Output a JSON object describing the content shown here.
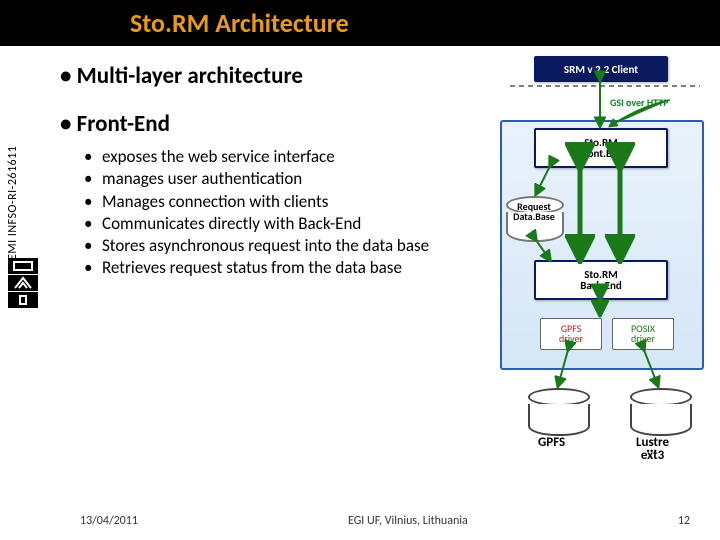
{
  "title": "Sto.RM Architecture",
  "side_id": "EMI INFSO-RI-261611",
  "bullets": {
    "b1": "Multi-layer architecture",
    "b2": "Front-End",
    "sub": [
      "exposes the web service interface",
      "manages user authentication",
      "Manages connection with clients",
      "Communicates directly with Back-End",
      "Stores asynchronous request into the data base",
      "Retrieves request status from the data base"
    ]
  },
  "diagram": {
    "client": "SRM v 2.2 Client",
    "gsi": "GSI over HTTP",
    "frontend_l1": "Sto.RM",
    "frontend_l2": "Front.End",
    "db_l1": "Request",
    "db_l2": "Data.Base",
    "backend_l1": "Sto.RM",
    "backend_l2": "Back.End",
    "gpfs_l1": "GPFS",
    "gpfs_l2": "driver",
    "posix_l1": "POSIX",
    "posix_l2": "driver",
    "fs1": "GPFS",
    "fs2_l1": "Lustre",
    "fs2_l2": "ext3",
    "dots": "…"
  },
  "footer": {
    "date": "13/04/2011",
    "venue": "EGI UF, Vilnius, Lithuania",
    "page": "12"
  }
}
